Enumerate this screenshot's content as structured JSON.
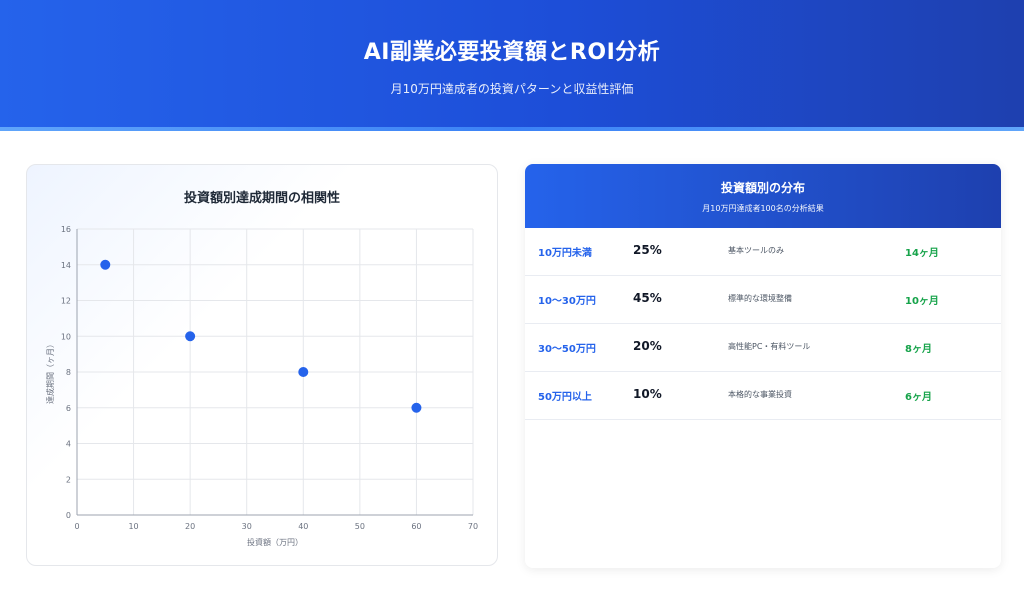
{
  "header": {
    "title": "AI副業必要投資額とROI分析",
    "subtitle": "月10万円達成者の投資パターンと収益性評価"
  },
  "chart_data": {
    "type": "scatter",
    "title": "投資額別達成期間の相関性",
    "xlabel": "投資額（万円）",
    "ylabel": "達成期間（ヶ月）",
    "xlim": [
      0,
      70
    ],
    "ylim": [
      0,
      16
    ],
    "xticks": [
      0,
      10,
      20,
      30,
      40,
      50,
      60,
      70
    ],
    "yticks": [
      0,
      2,
      4,
      6,
      8,
      10,
      12,
      14,
      16
    ],
    "grid": true,
    "point_color": "#2563eb",
    "points": [
      {
        "x": 5,
        "y": 14
      },
      {
        "x": 20,
        "y": 10
      },
      {
        "x": 40,
        "y": 8
      },
      {
        "x": 60,
        "y": 6
      }
    ]
  },
  "distribution": {
    "title": "投資額別の分布",
    "subtitle": "月10万円達成者100名の分析結果",
    "rows": [
      {
        "range": "10万円未満",
        "percent": "25%",
        "description": "基本ツールのみ",
        "period": "14ヶ月"
      },
      {
        "range": "10〜30万円",
        "percent": "45%",
        "description": "標準的な環境整備",
        "period": "10ヶ月"
      },
      {
        "range": "30〜50万円",
        "percent": "20%",
        "description": "高性能PC・有料ツール",
        "period": "8ヶ月"
      },
      {
        "range": "50万円以上",
        "percent": "10%",
        "description": "本格的な事業投資",
        "period": "6ヶ月"
      }
    ]
  }
}
